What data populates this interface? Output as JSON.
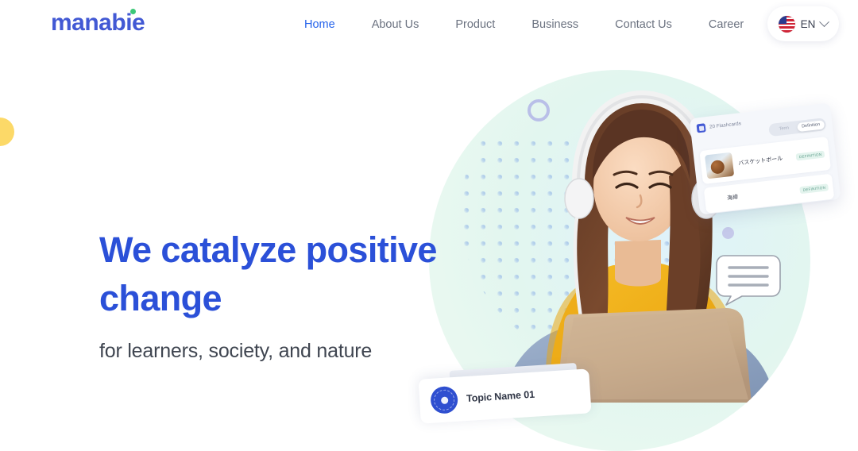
{
  "brand": {
    "logo_text": "manabie",
    "logo_color": "#4259d4",
    "accent_dot_color": "#3cc878"
  },
  "header": {
    "nav": [
      {
        "label": "Home",
        "active": true
      },
      {
        "label": "About Us",
        "active": false
      },
      {
        "label": "Product",
        "active": false
      },
      {
        "label": "Business",
        "active": false
      },
      {
        "label": "Contact Us",
        "active": false
      },
      {
        "label": "Career",
        "active": false
      }
    ],
    "language_selector": {
      "code": "EN",
      "flag_icon": "us-flag-icon",
      "chevron_icon": "chevron-down-icon"
    }
  },
  "hero": {
    "headline": "We catalyze positive change",
    "headline_color": "#2b50d8",
    "subheadline": "for learners, society, and nature",
    "subheadline_color": "#3f4550"
  },
  "decor": {
    "yellow_circle_color": "#fcd968",
    "mint_blob_color": "#e8f8f0",
    "ring_color": "#b9bfe8",
    "dot_color": "#c5c9ea",
    "dot_grid_color": "#bcd0ec"
  },
  "photo": {
    "alt": "Smiling woman wearing white headphones and a yellow sweater using a laptop",
    "sweater_color": "#f0b323",
    "laptop_color": "#c9ae8c"
  },
  "flashcard_widget": {
    "title": "20 Flashcards",
    "app_icon": "flashcards-app-icon",
    "toggle": {
      "inactive_label": "Term",
      "active_label": "Definition"
    },
    "rows": [
      {
        "term": "バスケットボール",
        "badge": "DEFINITION",
        "has_image": true
      },
      {
        "term": "海岸",
        "badge": "DEFINITION",
        "has_image": false
      }
    ]
  },
  "speech_bubble": {
    "icon": "speech-bubble-icon",
    "line_count": 3
  },
  "topic_card": {
    "title": "Topic Name 01",
    "progress_icon": "circular-progress-icon",
    "accent_color": "#2f4fd0"
  }
}
